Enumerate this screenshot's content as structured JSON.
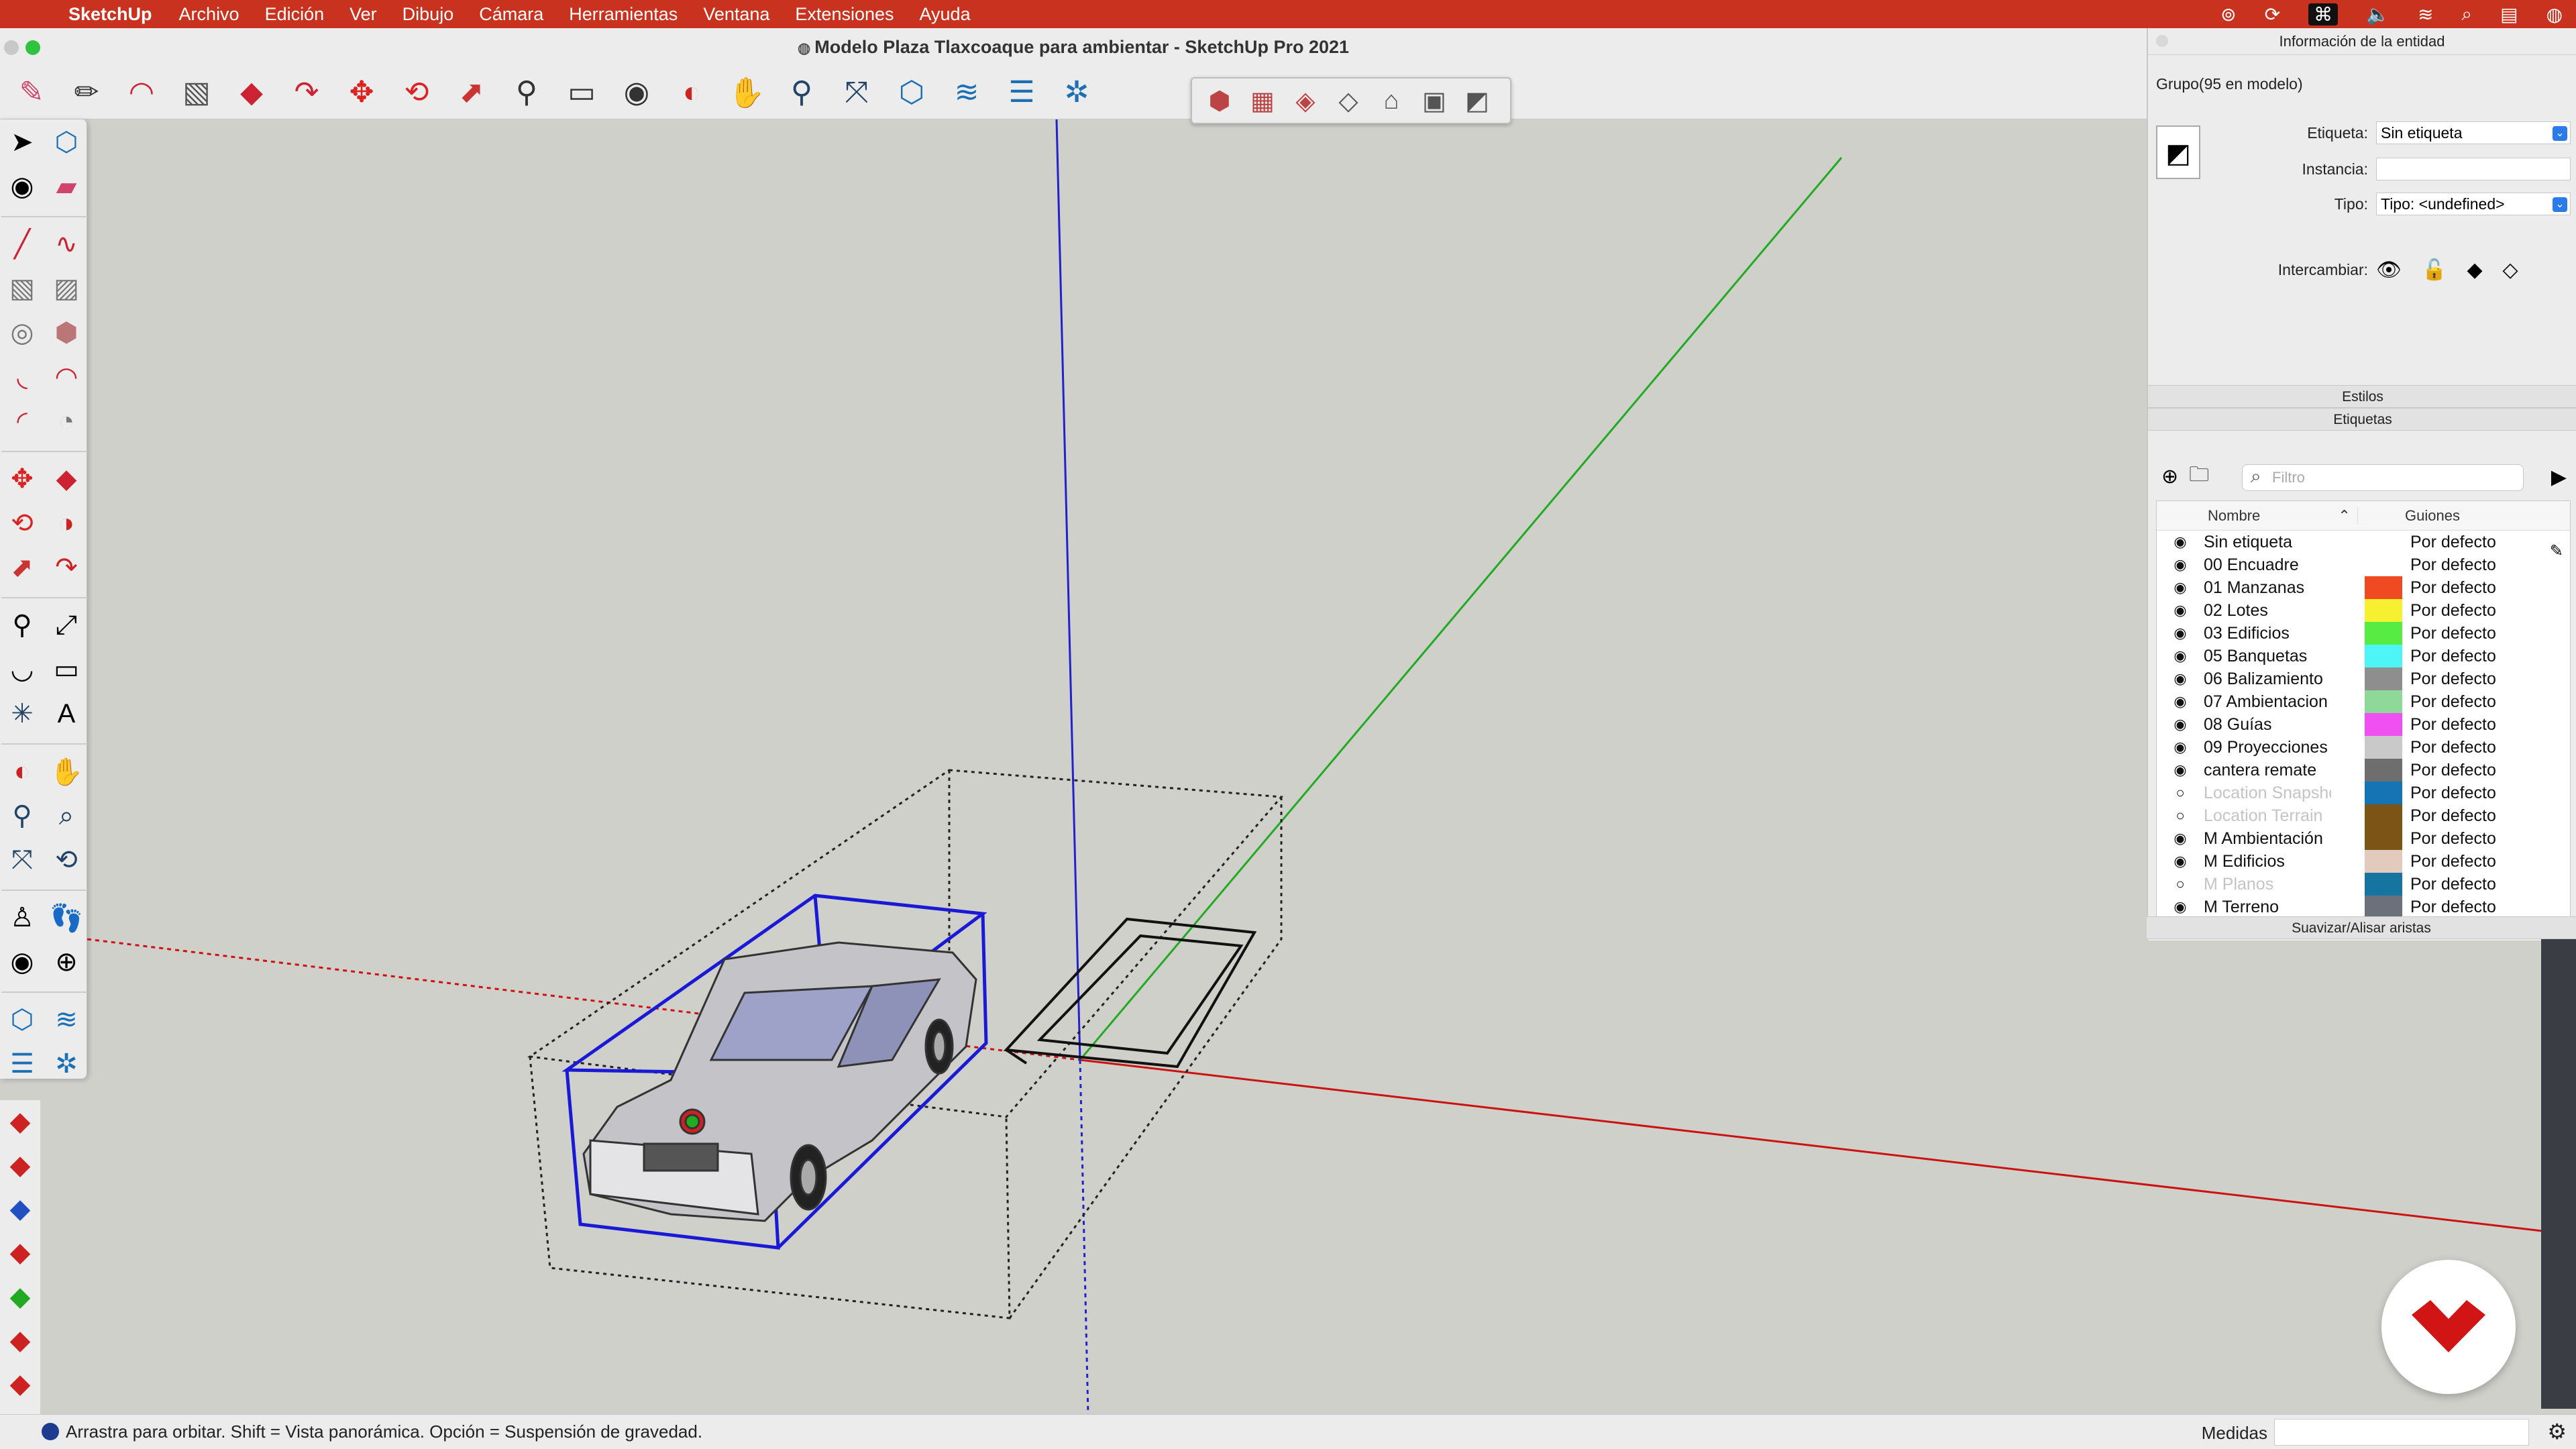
{
  "menubar": {
    "app": "SketchUp",
    "items": [
      "Archivo",
      "Edición",
      "Ver",
      "Dibujo",
      "Cámara",
      "Herramientas",
      "Ventana",
      "Extensiones",
      "Ayuda"
    ]
  },
  "window": {
    "title": "Modelo Plaza Tlaxcoaque para ambientar - SketchUp Pro 2021"
  },
  "entity_info": {
    "header": "Información de la entidad",
    "selection": "Grupo(95 en modelo)",
    "etiqueta_label": "Etiqueta:",
    "etiqueta_value": "Sin etiqueta",
    "instancia_label": "Instancia:",
    "instancia_value": "",
    "tipo_label": "Tipo:",
    "tipo_value": "Tipo: <undefined>",
    "intercambiar_label": "Intercambiar:"
  },
  "styles_header": "Estilos",
  "tags": {
    "header": "Etiquetas",
    "filter_placeholder": "Filtro",
    "col_name": "Nombre",
    "col_dashes": "Guiones",
    "rows": [
      {
        "name": "Sin etiqueta",
        "visible": true,
        "color": "",
        "dash": "Por defecto"
      },
      {
        "name": "00 Encuadre",
        "visible": true,
        "color": "",
        "dash": "Por defecto"
      },
      {
        "name": "01 Manzanas",
        "visible": true,
        "color": "#f04a22",
        "dash": "Por defecto"
      },
      {
        "name": "02 Lotes",
        "visible": true,
        "color": "#f6f031",
        "dash": "Por defecto"
      },
      {
        "name": "03 Edificios",
        "visible": true,
        "color": "#56ec44",
        "dash": "Por defecto"
      },
      {
        "name": "05 Banquetas",
        "visible": true,
        "color": "#4df4f8",
        "dash": "Por defecto"
      },
      {
        "name": "06 Balizamiento",
        "visible": true,
        "color": "#8e8e8e",
        "dash": "Por defecto"
      },
      {
        "name": "07 Ambientacion",
        "visible": true,
        "color": "#8ed89a",
        "dash": "Por defecto"
      },
      {
        "name": "08 Guías",
        "visible": true,
        "color": "#f04ff2",
        "dash": "Por defecto"
      },
      {
        "name": "09 Proyecciones",
        "visible": true,
        "color": "#c9c9c9",
        "dash": "Por defecto"
      },
      {
        "name": "cantera remate",
        "visible": true,
        "color": "#6e6e6e",
        "dash": "Por defecto"
      },
      {
        "name": "Location Snapshot",
        "visible": false,
        "color": "#1574b4",
        "dash": "Por defecto"
      },
      {
        "name": "Location Terrain",
        "visible": false,
        "color": "#7b5416",
        "dash": "Por defecto"
      },
      {
        "name": "M Ambientación",
        "visible": true,
        "color": "#7b5416",
        "dash": "Por defecto"
      },
      {
        "name": "M Edificios",
        "visible": true,
        "color": "#e2cabc",
        "dash": "Por defecto"
      },
      {
        "name": "M Planos",
        "visible": false,
        "color": "#1574a0",
        "dash": "Por defecto"
      },
      {
        "name": "M Terreno",
        "visible": true,
        "color": "#6b717a",
        "dash": "Por defecto"
      }
    ]
  },
  "soften_header": "Suavizar/Alisar aristas",
  "statusbar": {
    "hint": "Arrastra para orbitar. Shift = Vista panorámica. Opción = Suspensión de gravedad.",
    "measurements_label": "Medidas",
    "measurements_value": ""
  },
  "colors": {
    "menubar": "#c8321e",
    "selection": "#1a1ad6",
    "axis_red": "#cc1111",
    "axis_green": "#22aa22",
    "axis_blue": "#2222cc"
  },
  "icons": {
    "toolbar": [
      "eraser-icon",
      "pencil-icon",
      "arc-icon",
      "rectangle-icon",
      "pushpull-icon",
      "followme-icon",
      "move-icon",
      "rotate-icon",
      "scale-icon",
      "tape-icon",
      "text-icon",
      "paint-icon",
      "orbit-icon",
      "pan-icon",
      "zoom-icon",
      "zoom-extents-icon",
      "warehouse-icon",
      "extension-icon",
      "layers-icon",
      "sandbox-icon"
    ],
    "float_toolbar": [
      "iso-view-icon",
      "top-view-icon",
      "front-view-icon",
      "right-view-icon",
      "back-view-icon",
      "left-view-icon",
      "bottom-view-icon"
    ]
  }
}
